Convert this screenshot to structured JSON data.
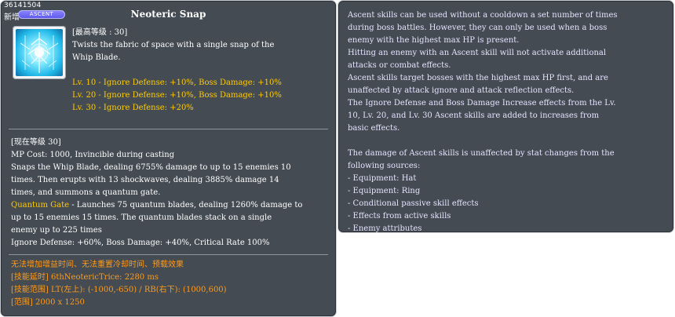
{
  "skill": {
    "id_text": "36141504",
    "new_tag": "新增",
    "badge": "ASCENT",
    "name": "Neoteric Snap",
    "max_level_label": "[最高等级 : 30]",
    "description": [
      "Twists the fabric of space with a single snap of the",
      "Whip Blade."
    ],
    "level_bonuses": [
      "Lv. 10 - Ignore Defense: +10%, Boss Damage: +10%",
      "Lv. 20 - Ignore Defense: +10%, Boss Damage: +10%",
      "Lv. 30 - Ignore Defense: +20%"
    ],
    "current_level_label": "[现在等级 30]",
    "current": {
      "mp_cost": "MP Cost: 1000, Invincible during casting",
      "lines": [
        "Snaps the Whip Blade, dealing 6755% damage to up to 15 enemies 10",
        "times. Then erupts with 13 shockwaves, dealing 3885% damage 14",
        "times, and summons a quantum gate."
      ],
      "quantum_gate_label": "Quantum Gate",
      "quantum_gate_lines": [
        " - Launches 75 quantum blades, dealing 1260% damage to",
        "up to 15 enemies 15 times. The quantum blades stack on a single",
        "enemy up to 225 times"
      ],
      "bonus_line": "Ignore Defense: +60%, Boss Damage: +40%, Critical Rate 100%"
    },
    "notes": [
      "无法增加增益时间、无法重置冷却时间、预载效果",
      "[技能延时] 6thNeotericTrice: 2280 ms",
      "[技能范围] LT(左上): (-1000,-650) / RB(右下): (1000,600)",
      "[范围] 2000 x 1250"
    ]
  },
  "ascent_info": {
    "lines": [
      "Ascent skills can be used without a cooldown a set number of times",
      " during boss battles. However, they can only be used when a boss",
      "enemy with the highest max HP is present.",
      "Hitting an enemy with an Ascent skill will not activate additional",
      " attacks or combat effects.",
      "Ascent skills target bosses with the highest max HP first, and are",
      " unaffected by attack ignore and attack reflection effects.",
      "The Ignore Defense and Boss Damage Increase effects from the Lv.",
      "10, Lv. 20, and Lv. 30 Ascent skills are added to increases from",
      "basic effects.",
      "",
      "The damage of Ascent skills is unaffected by stat changes from the",
      " following sources:",
      "- Equipment: Hat",
      "- Equipment: Ring",
      "- Conditional passive skill effects",
      "- Effects from active skills",
      "- Enemy attributes"
    ]
  },
  "colors": {
    "panel_bg": "#444b53",
    "highlight_yellow": "#ffcc00",
    "note_orange": "#ff9b1a",
    "info_text": "#e6e4ff",
    "badge_purple": "#6f6af0"
  },
  "icons": {
    "skill_icon": "neoteric-snap-skill-icon"
  }
}
